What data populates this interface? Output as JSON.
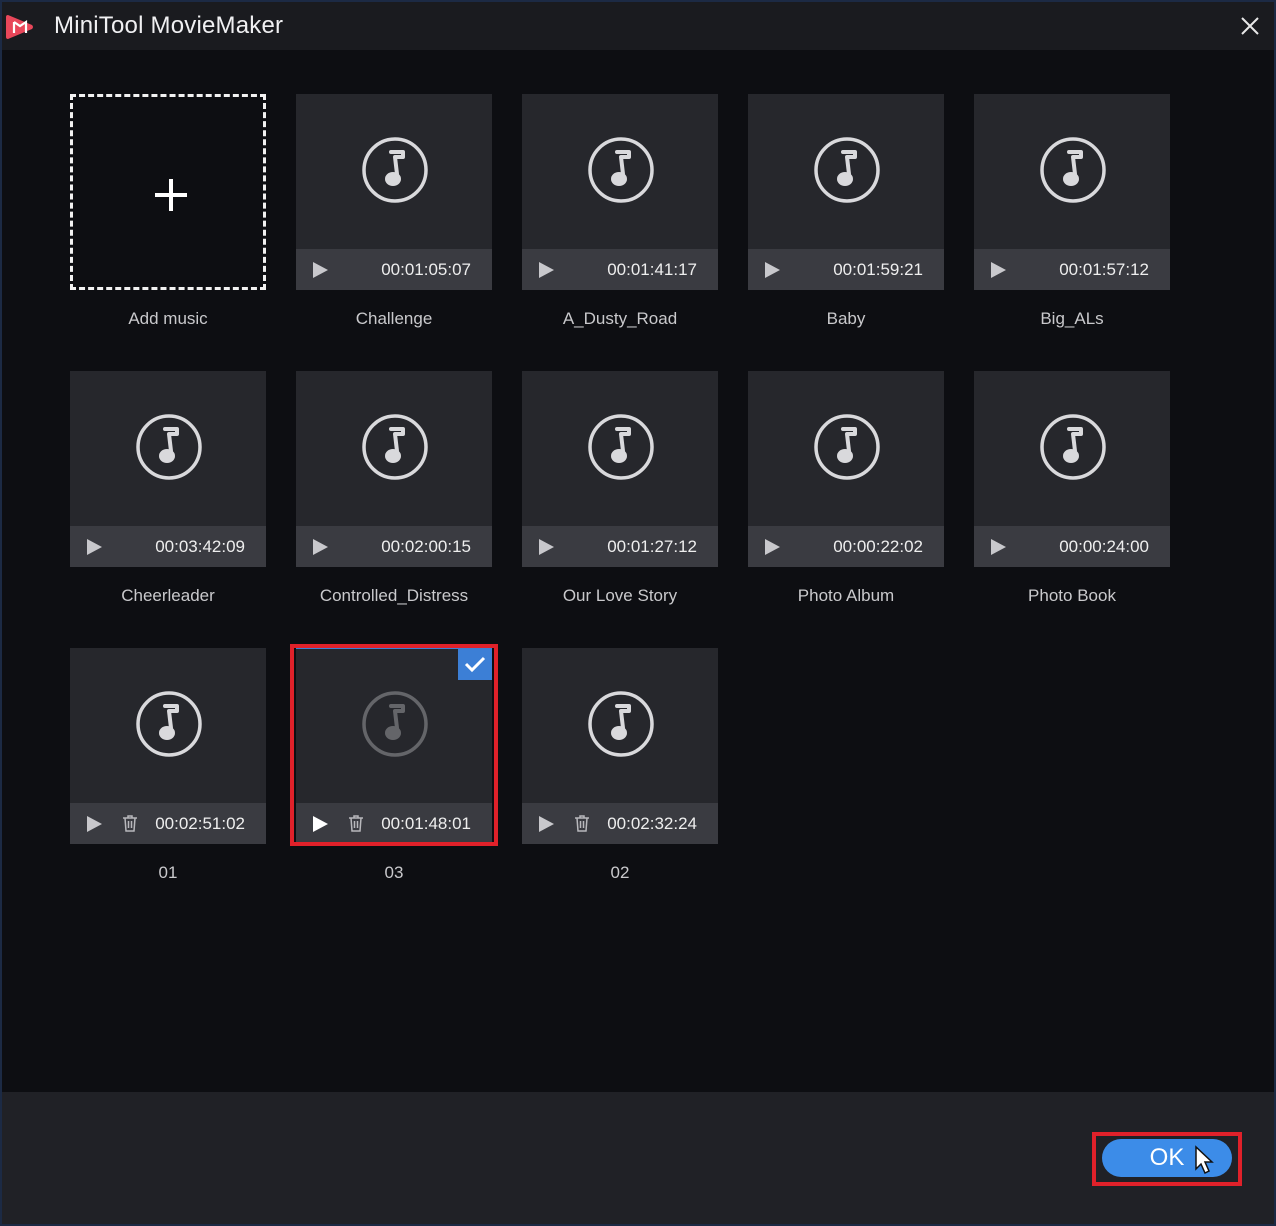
{
  "window": {
    "title": "MiniTool MovieMaker"
  },
  "add_music": {
    "label": "Add music"
  },
  "tracks": [
    {
      "name": "Challenge",
      "duration": "00:01:05:07",
      "deletable": false,
      "selected": false
    },
    {
      "name": "A_Dusty_Road",
      "duration": "00:01:41:17",
      "deletable": false,
      "selected": false
    },
    {
      "name": "Baby",
      "duration": "00:01:59:21",
      "deletable": false,
      "selected": false
    },
    {
      "name": "Big_ALs",
      "duration": "00:01:57:12",
      "deletable": false,
      "selected": false
    },
    {
      "name": "Cheerleader",
      "duration": "00:03:42:09",
      "deletable": false,
      "selected": false
    },
    {
      "name": "Controlled_Distress",
      "duration": "00:02:00:15",
      "deletable": false,
      "selected": false
    },
    {
      "name": "Our Love Story",
      "duration": "00:01:27:12",
      "deletable": false,
      "selected": false
    },
    {
      "name": "Photo Album",
      "duration": "00:00:22:02",
      "deletable": false,
      "selected": false
    },
    {
      "name": "Photo Book",
      "duration": "00:00:24:00",
      "deletable": false,
      "selected": false
    },
    {
      "name": "01",
      "duration": "00:02:51:02",
      "deletable": true,
      "selected": false
    },
    {
      "name": "03",
      "duration": "00:01:48:01",
      "deletable": true,
      "selected": true
    },
    {
      "name": "02",
      "duration": "00:02:32:24",
      "deletable": true,
      "selected": false
    }
  ],
  "footer": {
    "ok_label": "OK"
  },
  "colors": {
    "accent": "#3c8ce8",
    "highlight": "#e0212a",
    "tile": "#26272c",
    "tile_bar": "#3a3b41"
  },
  "icons": {
    "logo": "app-logo-icon",
    "close": "close-icon",
    "music": "music-note-icon",
    "play": "play-icon",
    "delete": "trash-icon",
    "check": "checkmark-icon",
    "add": "plus-icon"
  }
}
